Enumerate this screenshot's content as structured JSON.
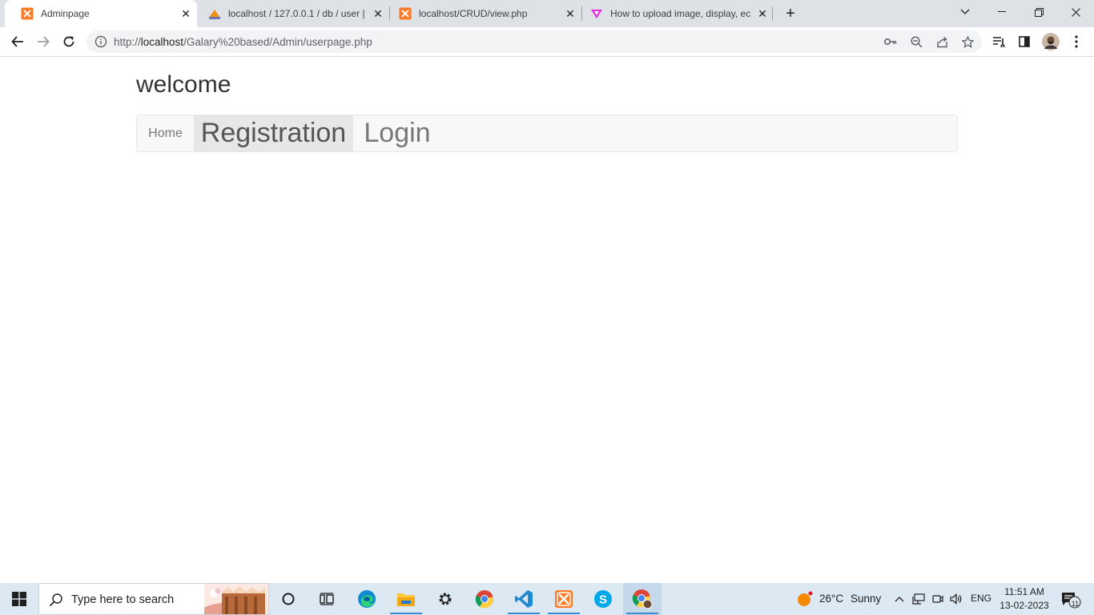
{
  "browser": {
    "tabs": [
      {
        "title": "Adminpage",
        "icon": "xampp-icon",
        "active": true
      },
      {
        "title": "localhost / 127.0.0.1 / db / user | ",
        "icon": "phpmyadmin-icon",
        "active": false
      },
      {
        "title": "localhost/CRUD/view.php",
        "icon": "xampp-icon",
        "active": false
      },
      {
        "title": "How to upload image, display, ec",
        "icon": "video-site-icon",
        "active": false
      }
    ],
    "url_prefix": "http://",
    "url_host": "localhost",
    "url_path": "/Galary%20based/Admin/userpage.php"
  },
  "page": {
    "heading": "welcome",
    "nav": {
      "home": "Home",
      "registration": "Registration",
      "login": "Login"
    }
  },
  "taskbar": {
    "search_placeholder": "Type here to search",
    "weather_temp": "26°C",
    "weather_text": "Sunny",
    "language": "ENG",
    "time": "11:51 AM",
    "date": "13-02-2023",
    "notification_count": "11"
  },
  "colors": {
    "tabstrip_bg": "#dee1e6",
    "navbar_bg": "#f8f8f8",
    "nav_active_bg": "#e7e7e7",
    "taskbar_bg": "#dce9f3",
    "xampp_orange": "#fb7a24"
  }
}
